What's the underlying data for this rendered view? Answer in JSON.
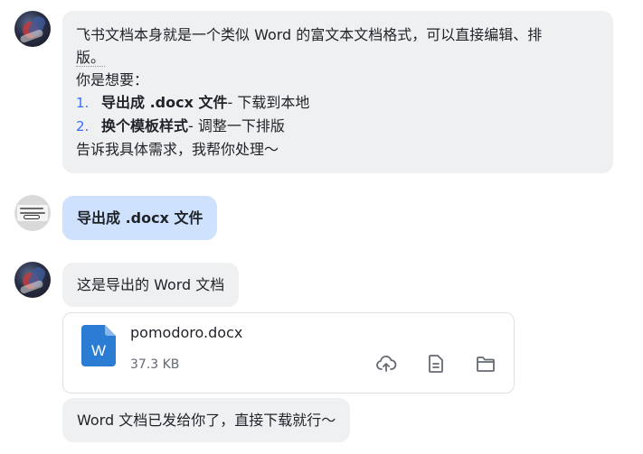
{
  "messages": {
    "m1": {
      "line1": "飞书文档本身就是一个类似 Word 的富文本文档格式，可以直接编辑、排",
      "line2": "版。",
      "line3": "你是想要：",
      "options": [
        {
          "num": "1.",
          "title": "导出成 .docx 文件",
          "desc": " - 下载到本地"
        },
        {
          "num": "2.",
          "title": "换个模板样式",
          "desc": " - 调整一下排版"
        }
      ],
      "line_last": "告诉我具体需求，我帮你处理～"
    },
    "m2": {
      "text": "导出成 .docx 文件"
    },
    "m3": {
      "text": "这是导出的 Word 文档"
    },
    "file": {
      "icon_letter": "W",
      "name": "pomodoro.docx",
      "size": "37.3 KB",
      "icons": [
        "cloud-upload-icon",
        "document-preview-icon",
        "folder-icon"
      ]
    },
    "m4": {
      "text": "Word 文档已发给你了，直接下载就行～"
    }
  },
  "colors": {
    "bubble_gray": "#eff0f1",
    "bubble_blue": "#cfe2fd",
    "accent": "#3370ff",
    "word_blue": "#2b7cd3"
  }
}
